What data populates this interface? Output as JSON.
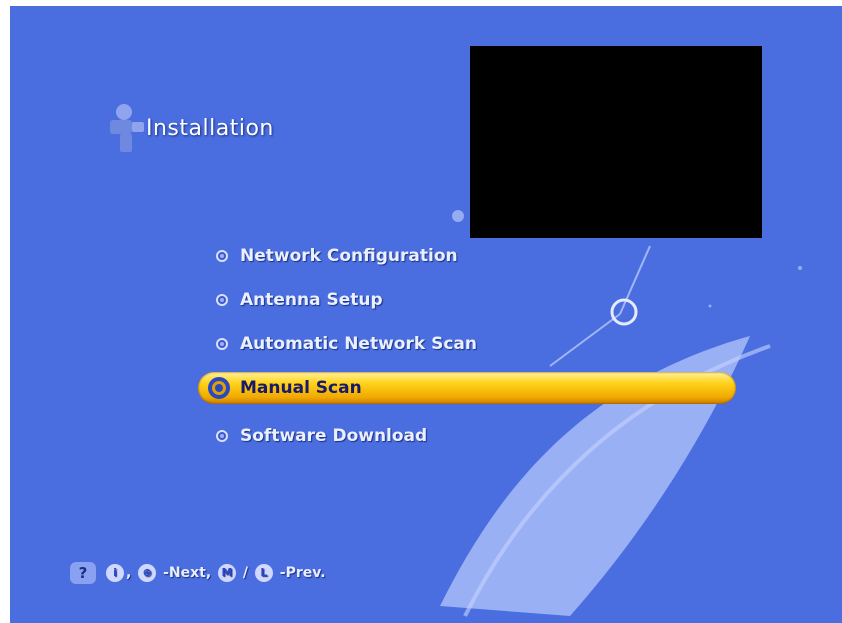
{
  "header": {
    "title": "Installation",
    "icon": "installation-icon"
  },
  "menu": {
    "items": [
      {
        "label": "Network Configuration"
      },
      {
        "label": "Antenna Setup"
      },
      {
        "label": "Automatic Network Scan"
      },
      {
        "label": "Manual Scan",
        "selected": true
      },
      {
        "label": "Software Download"
      }
    ]
  },
  "footer": {
    "help_icon": "?",
    "key1": "i",
    "key2": "⊕",
    "next_text": "-Next,",
    "key3": "M",
    "slash": "/",
    "key4": "L",
    "prev_text": "-Prev."
  },
  "colors": {
    "background": "#4a6ee0",
    "highlight": "#ffd21a",
    "text": "#eaf0ff"
  }
}
